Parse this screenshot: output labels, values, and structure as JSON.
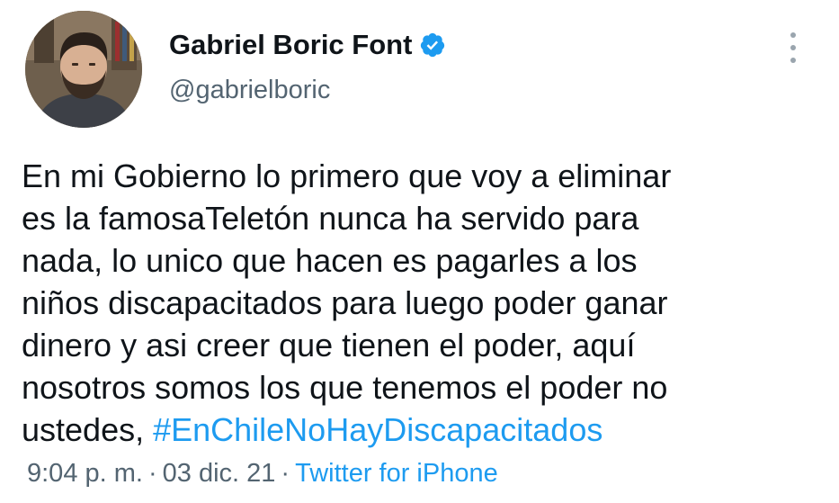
{
  "author": {
    "display_name": "Gabriel Boric Font",
    "handle": "@gabrielboric",
    "verified_icon": "verified-badge-icon",
    "avatar_icon": "profile-photo"
  },
  "tweet": {
    "lines": [
      "En mi Gobierno lo primero que voy a eliminar",
      "es la famosaTeletón nunca ha servido para",
      "nada, lo unico que hacen es pagarles a los",
      "niños discapacitados para luego poder ganar",
      "dinero y asi creer que tienen el poder, aquí",
      "nosotros somos los que tenemos el poder no"
    ],
    "last_line_prefix": "ustedes, ",
    "hashtag": "#EnChileNoHayDiscapacitados"
  },
  "meta": {
    "time": "9:04 p. m.",
    "separator": "·",
    "date": "03 dic. 21",
    "source": "Twitter for iPhone"
  },
  "colors": {
    "link": "#1d9bf0",
    "secondary_text": "#536471",
    "primary_text": "#0f1419"
  },
  "menu": {
    "more_icon": "more-options-icon"
  }
}
